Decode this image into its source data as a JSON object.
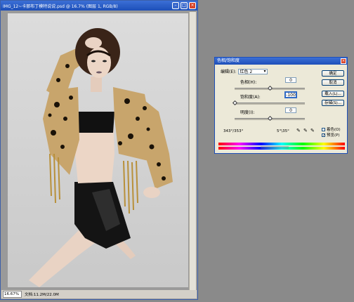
{
  "document": {
    "title": "IMG_12~卡那布丁模特说说.psd @ 16.7% (图层 1, RGB/8)",
    "zoom": "16.67%",
    "doc_info": "文档:11.2M/22.0M"
  },
  "dialog": {
    "title": "色相/饱和度",
    "edit_label": "编辑(E):",
    "edit_value": "红色 2",
    "hue_label": "色相(H):",
    "hue_value": "0",
    "saturation_label": "饱和度(A):",
    "saturation_value": "-100",
    "lightness_label": "明度(I):",
    "lightness_value": "0",
    "range_left": "343°/353°",
    "range_right": "5°\\35°",
    "buttons": {
      "ok": "确定",
      "cancel": "取消",
      "load": "载入(L)...",
      "save": "存储(S)..."
    },
    "colorize_label": "着色(O)",
    "colorize_checked": false,
    "preview_label": "预览(P)",
    "preview_checked": true,
    "hue_fraction": 0.5,
    "saturation_fraction": 0.0,
    "lightness_fraction": 0.5
  },
  "icons": [
    "minimize-icon",
    "maximize-icon",
    "close-icon",
    "eyedropper-icon",
    "eyedropper-plus-icon",
    "eyedropper-minus-icon"
  ]
}
